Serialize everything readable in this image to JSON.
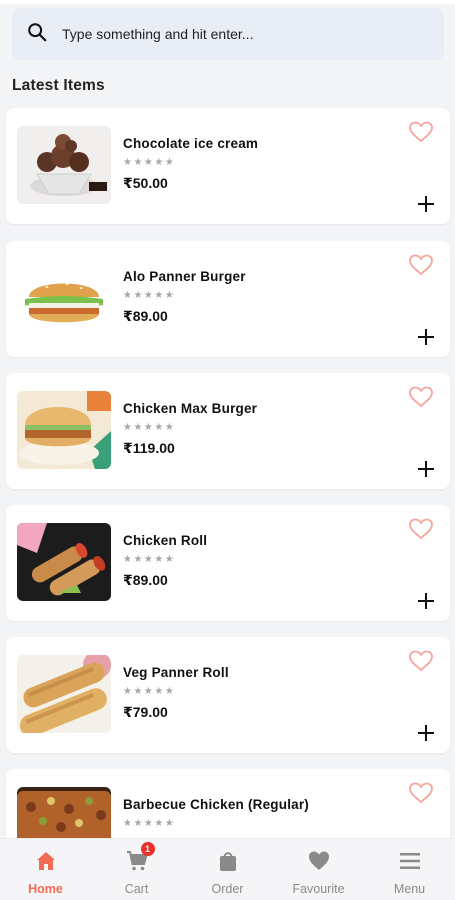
{
  "search": {
    "placeholder": "Type something and hit enter..."
  },
  "section": {
    "title": "Latest Items"
  },
  "items": [
    {
      "name": "Chocolate ice cream",
      "rating": "★★★★★",
      "price": "₹50.00",
      "image": "chocolate-ice-cream"
    },
    {
      "name": "Alo Panner Burger",
      "rating": "★★★★★",
      "price": "₹89.00",
      "image": "burger"
    },
    {
      "name": "Chicken Max Burger",
      "rating": "★★★★★",
      "price": "₹119.00",
      "image": "burger"
    },
    {
      "name": "Chicken Roll",
      "rating": "★★★★★",
      "price": "₹89.00",
      "image": "roll"
    },
    {
      "name": "Veg Panner Roll",
      "rating": "★★★★★",
      "price": "₹79.00",
      "image": "roll"
    },
    {
      "name": "Barbecue Chicken (Regular)",
      "rating": "★★★★★",
      "price": "",
      "image": "pizza"
    }
  ],
  "nav": {
    "home": "Home",
    "cart": "Cart",
    "cart_badge": "1",
    "order": "Order",
    "favourite": "Favourite",
    "menu": "Menu"
  },
  "colors": {
    "accent": "#f26b55",
    "heart": "#f4a49a",
    "badge": "#e8312a",
    "inactive": "#8a8a8a"
  },
  "icons": {
    "search": "search-icon",
    "favourite": "heart-outline-icon",
    "add": "plus-icon",
    "home": "home-icon",
    "cart": "cart-icon",
    "order": "bag-icon",
    "favourite_nav": "heart-icon",
    "menu": "hamburger-icon"
  }
}
